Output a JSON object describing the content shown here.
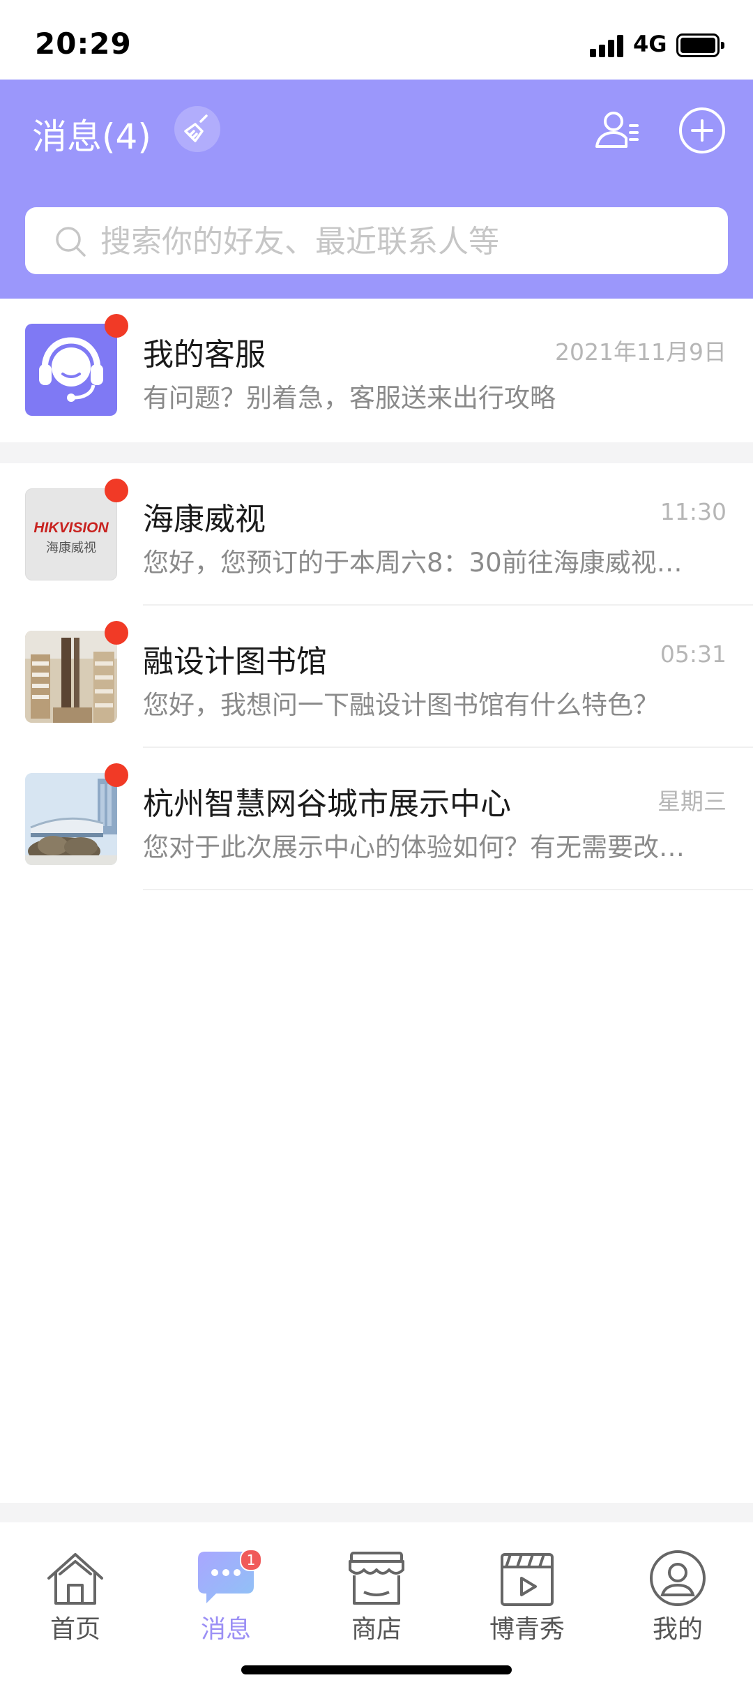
{
  "status_bar": {
    "time": "20:29",
    "network": "4G"
  },
  "header": {
    "title": "消息(4)",
    "search_placeholder": "搜索你的好友、最近联系人等"
  },
  "conversations": [
    {
      "name": "我的客服",
      "time": "2021年11月9日",
      "preview": "有问题？别着急，客服送来出行攻略",
      "unread": true,
      "avatar": "headset-icon"
    },
    {
      "name": "海康威视",
      "time": "11:30",
      "preview": "您好，您预订的于本周六8：30前往海康威视…",
      "unread": true,
      "avatar": "hikvision-logo",
      "logo_text": "HIKVISION",
      "logo_subtext": "海康威视"
    },
    {
      "name": "融设计图书馆",
      "time": "05:31",
      "preview": "您好，我想问一下融设计图书馆有什么特色？",
      "unread": true,
      "avatar": "library-photo"
    },
    {
      "name": "杭州智慧网谷城市展示中心",
      "time": "星期三",
      "preview": "您对于此次展示中心的体验如何？有无需要改…",
      "unread": true,
      "avatar": "building-photo"
    }
  ],
  "tabbar": {
    "items": [
      {
        "label": "首页",
        "icon": "home-icon",
        "active": false
      },
      {
        "label": "消息",
        "icon": "chat-bubble-icon",
        "active": true,
        "badge": "1"
      },
      {
        "label": "商店",
        "icon": "shop-icon",
        "active": false
      },
      {
        "label": "博青秀",
        "icon": "clapperboard-icon",
        "active": false
      },
      {
        "label": "我的",
        "icon": "user-icon",
        "active": false
      }
    ]
  },
  "colors": {
    "header": "#9b97fb",
    "accent": "#9b8ff5",
    "unread_dot": "#f13a26"
  }
}
